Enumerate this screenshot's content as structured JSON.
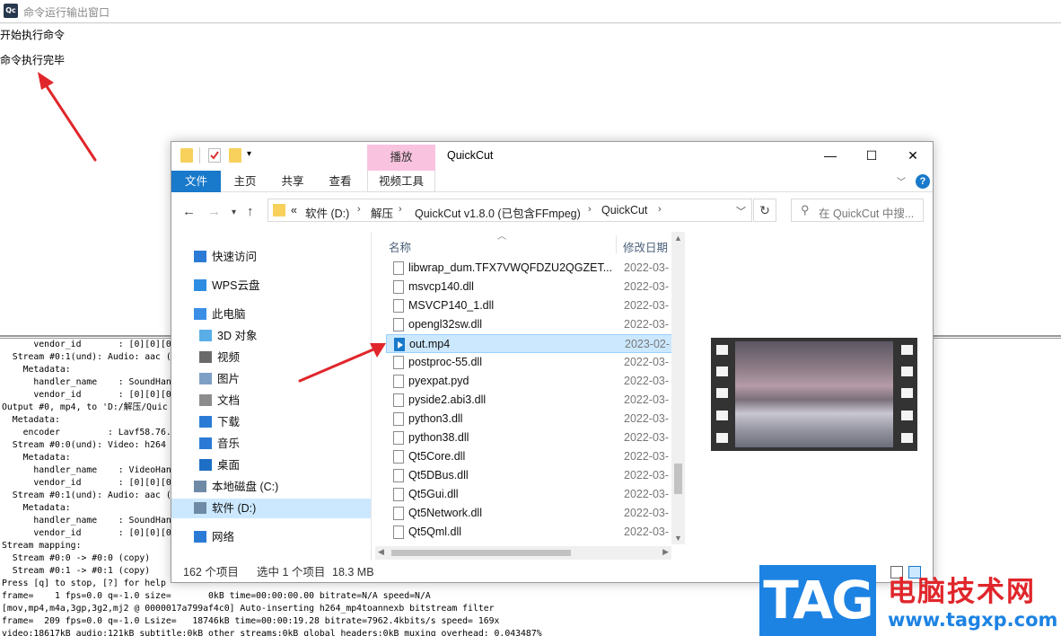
{
  "window": {
    "title": "命令运行输出窗口",
    "logo": "Qc"
  },
  "output": {
    "line1": "开始执行命令",
    "line2": "命令执行完毕"
  },
  "console_lines": [
    "      vendor_id       : [0][0][0",
    "  Stream #0:1(und): Audio: aac (",
    "    Metadata:",
    "      handler_name    : SoundHan",
    "      vendor_id       : [0][0][0",
    "Output #0, mp4, to 'D:/解压/Quic",
    "  Metadata:",
    "    encoder         : Lavf58.76.",
    "  Stream #0:0(und): Video: h264",
    "    Metadata:",
    "      handler_name    : VideoHan",
    "      vendor_id       : [0][0][0",
    "  Stream #0:1(und): Audio: aac (",
    "    Metadata:",
    "      handler_name    : SoundHan",
    "      vendor_id       : [0][0][0",
    "Stream mapping:",
    "  Stream #0:0 -> #0:0 (copy)",
    "  Stream #0:1 -> #0:1 (copy)",
    "Press [q] to stop, [?] for help",
    "frame=    1 fps=0.0 q=-1.0 size=       0kB time=00:00:00.00 bitrate=N/A speed=N/A",
    "[mov,mp4,m4a,3gp,3g2,mj2 @ 0000017a799af4c0] Auto-inserting h264_mp4toannexb bitstream filter",
    "frame=  209 fps=0.0 q=-1.0 Lsize=   18746kB time=00:00:19.28 bitrate=7962.4kbits/s speed= 169x",
    "video:18617kB audio:121kB subtitle:0kB other streams:0kB global headers:0kB muxing overhead: 0.043487%"
  ],
  "explorer": {
    "title": "QuickCut",
    "context_tab": "播放",
    "context_sub": "视频工具",
    "ribbon_tabs": [
      "文件",
      "主页",
      "共享",
      "查看"
    ],
    "window_buttons": {
      "minimize": "—",
      "maximize": "☐",
      "close": "✕"
    },
    "address": {
      "prefix": "«",
      "crumbs": [
        "软件 (D:)",
        "解压",
        "QuickCut v1.8.0 (已包含FFmpeg)",
        "QuickCut"
      ]
    },
    "search_placeholder": "在 QuickCut 中搜...",
    "nav": [
      {
        "label": "快速访问",
        "icon": "star-icon"
      },
      {
        "label": "WPS云盘",
        "icon": "cloud-icon"
      },
      {
        "label": "此电脑",
        "icon": "computer-icon"
      },
      {
        "label": "3D 对象",
        "icon": "cube-icon"
      },
      {
        "label": "视频",
        "icon": "video-icon"
      },
      {
        "label": "图片",
        "icon": "picture-icon"
      },
      {
        "label": "文档",
        "icon": "document-icon"
      },
      {
        "label": "下载",
        "icon": "download-icon"
      },
      {
        "label": "音乐",
        "icon": "music-icon"
      },
      {
        "label": "桌面",
        "icon": "desktop-icon"
      },
      {
        "label": "本地磁盘 (C:)",
        "icon": "drive-icon"
      },
      {
        "label": "软件 (D:)",
        "icon": "drive-icon",
        "selected": true
      },
      {
        "label": "网络",
        "icon": "network-icon"
      }
    ],
    "columns": {
      "name": "名称",
      "date": "修改日期"
    },
    "files": [
      {
        "name": "libwrap_dum.TFX7VWQFDZU2QGZET...",
        "date": "2022-03-"
      },
      {
        "name": "msvcp140.dll",
        "date": "2022-03-"
      },
      {
        "name": "MSVCP140_1.dll",
        "date": "2022-03-"
      },
      {
        "name": "opengl32sw.dll",
        "date": "2022-03-"
      },
      {
        "name": "out.mp4",
        "date": "2023-02-",
        "selected": true,
        "type": "mp4"
      },
      {
        "name": "postproc-55.dll",
        "date": "2022-03-"
      },
      {
        "name": "pyexpat.pyd",
        "date": "2022-03-"
      },
      {
        "name": "pyside2.abi3.dll",
        "date": "2022-03-"
      },
      {
        "name": "python3.dll",
        "date": "2022-03-"
      },
      {
        "name": "python38.dll",
        "date": "2022-03-"
      },
      {
        "name": "Qt5Core.dll",
        "date": "2022-03-"
      },
      {
        "name": "Qt5DBus.dll",
        "date": "2022-03-"
      },
      {
        "name": "Qt5Gui.dll",
        "date": "2022-03-"
      },
      {
        "name": "Qt5Network.dll",
        "date": "2022-03-"
      },
      {
        "name": "Qt5Qml.dll",
        "date": "2022-03-"
      }
    ],
    "status": {
      "count": "162 个项目",
      "selected": "选中 1 个项目",
      "size": "18.3 MB"
    }
  },
  "watermark": {
    "tag": "TAG",
    "cn": "电脑技术网",
    "url": "www.tagxp.com"
  },
  "colors": {
    "accent": "#1979ca",
    "context_tab": "#f9c3df",
    "arrow": "#e0262b",
    "selection": "#cce8ff"
  }
}
